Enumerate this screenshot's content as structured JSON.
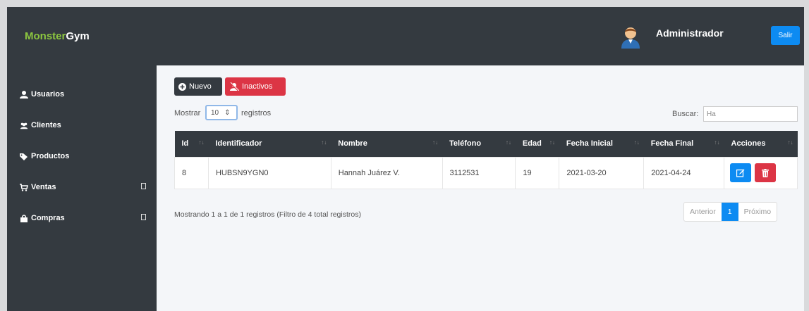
{
  "header": {
    "brand_part1": "Monster",
    "brand_part2": "Gym",
    "user_name": "Administrador",
    "logout_label": "Salir"
  },
  "sidebar": {
    "items": [
      {
        "label": "Usuarios",
        "icon": "user-icon"
      },
      {
        "label": "Clientes",
        "icon": "users-icon"
      },
      {
        "label": "Productos",
        "icon": "tags-icon"
      },
      {
        "label": "Ventas",
        "icon": "cart-icon",
        "expandable": true
      },
      {
        "label": "Compras",
        "icon": "bag-icon",
        "expandable": true
      }
    ]
  },
  "toolbar": {
    "new_label": "Nuevo",
    "inactive_label": "Inactivos"
  },
  "table_controls": {
    "show_label": "Mostrar",
    "page_size": "10",
    "records_label": "registros",
    "search_label": "Buscar:",
    "search_value": "Ha"
  },
  "table": {
    "columns": [
      "Id",
      "Identificador",
      "Nombre",
      "Teléfono",
      "Edad",
      "Fecha Inicial",
      "Fecha Final",
      "Acciones"
    ],
    "rows": [
      {
        "id": "8",
        "identificador": "HUBSN9YGN0",
        "nombre": "Hannah Juárez V.",
        "telefono": "3112531",
        "edad": "19",
        "fecha_inicial": "2021-03-20",
        "fecha_final": "2021-04-24"
      }
    ]
  },
  "footer": {
    "info": "Mostrando 1 a 1 de 1 registros (Filtro de 4 total registros)",
    "prev_label": "Anterior",
    "current_page": "1",
    "next_label": "Próximo"
  },
  "colors": {
    "dark": "#343a40",
    "primary": "#0d8bf2",
    "danger": "#dc3545",
    "brand_green": "#8cc63f"
  }
}
